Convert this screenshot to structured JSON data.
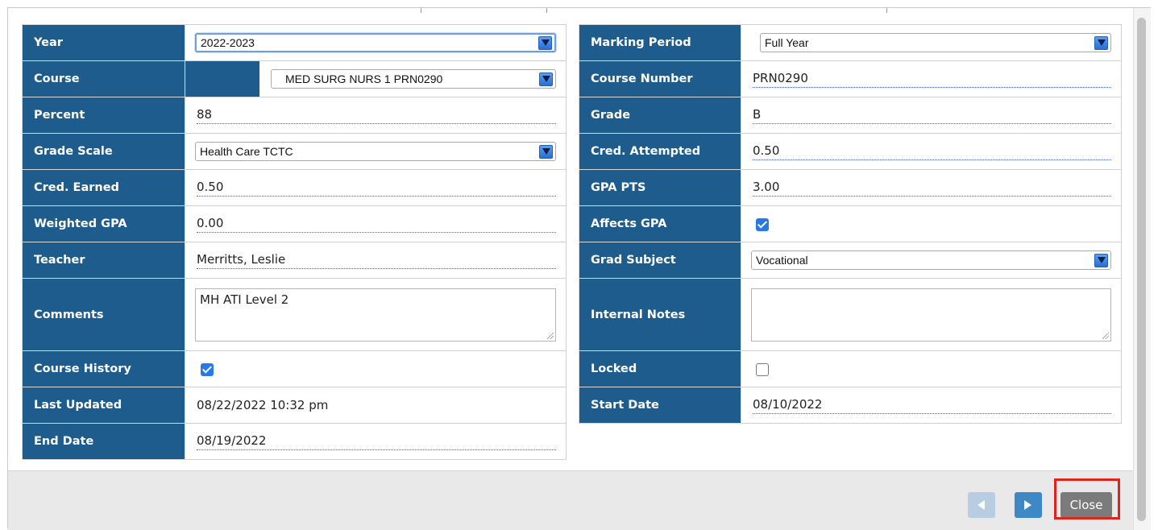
{
  "left_fields": {
    "year": {
      "label": "Year",
      "value": "2022-2023"
    },
    "course": {
      "label": "Course",
      "value": "MED SURG NURS 1 PRN0290"
    },
    "percent": {
      "label": "Percent",
      "value": "88"
    },
    "grade_scale": {
      "label": "Grade Scale",
      "value": "Health Care TCTC"
    },
    "cred_earned": {
      "label": "Cred. Earned",
      "value": "0.50"
    },
    "weighted_gpa": {
      "label": "Weighted GPA",
      "value": "0.00"
    },
    "teacher": {
      "label": "Teacher",
      "value": "Merritts, Leslie"
    },
    "comments": {
      "label": "Comments",
      "value": "MH ATI Level  2"
    },
    "course_history": {
      "label": "Course History",
      "checked": true
    },
    "last_updated": {
      "label": "Last Updated",
      "value": "08/22/2022 10:32 pm"
    },
    "end_date": {
      "label": "End Date",
      "value": "08/19/2022"
    }
  },
  "right_fields": {
    "marking_period": {
      "label": "Marking Period",
      "value": "Full Year"
    },
    "course_number": {
      "label": "Course Number",
      "value": "PRN0290"
    },
    "grade": {
      "label": "Grade",
      "value": "B"
    },
    "cred_attempted": {
      "label": "Cred. Attempted",
      "value": "0.50"
    },
    "gpa_pts": {
      "label": "GPA PTS",
      "value": "3.00"
    },
    "affects_gpa": {
      "label": "Affects GPA",
      "checked": true
    },
    "grad_subject": {
      "label": "Grad Subject",
      "value": "Vocational"
    },
    "internal_notes": {
      "label": "Internal Notes",
      "value": ""
    },
    "locked": {
      "label": "Locked",
      "checked": false
    },
    "start_date": {
      "label": "Start Date",
      "value": "08/10/2022"
    }
  },
  "footer": {
    "prev_icon": "triangle-left-icon",
    "next_icon": "triangle-right-icon",
    "close_label": "Close"
  },
  "colors": {
    "label_bg": "#1f5c8e",
    "close_bg": "#7b7b7b",
    "highlight": "#e0241b",
    "checkbox": "#2a78e8"
  }
}
